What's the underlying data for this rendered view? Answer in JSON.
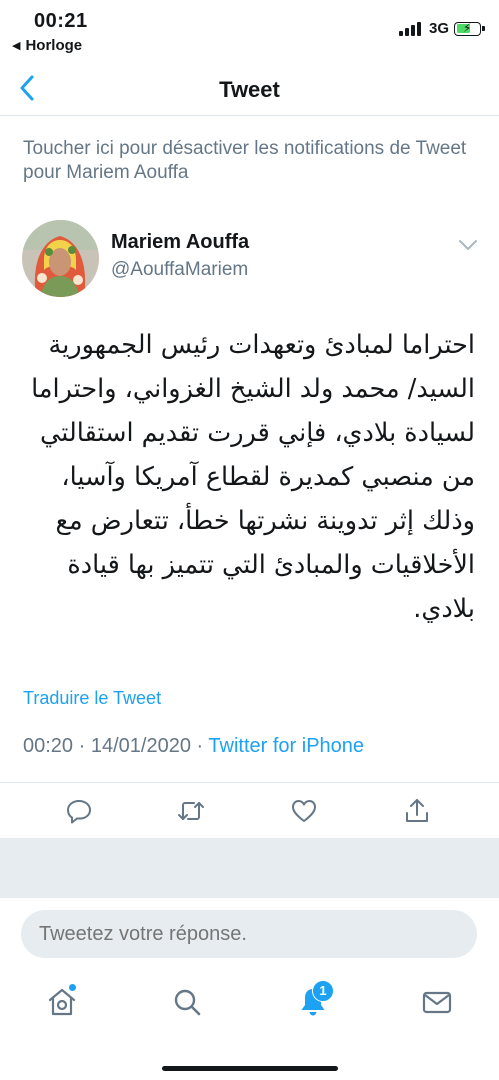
{
  "status_bar": {
    "time": "00:21",
    "back_app": "Horloge",
    "network": "3G"
  },
  "nav": {
    "title": "Tweet"
  },
  "notification_toggle": "Toucher ici pour désactiver les notifications de Tweet pour Mariem Aouffa",
  "tweet": {
    "author_name": "Mariem Aouffa",
    "author_handle": "@AouffaMariem",
    "text": "احتراما لمبادئ وتعهدات رئيس الجمهورية السيد/ محمد ولد الشيخ الغزواني، واحتراما لسيادة بلادي، فإني قررت تقديم استقالتي من منصبي كمديرة لقطاع آمريكا وآسيا، وذلك إثر تدوينة نشرتها خطأ، تتعارض مع الأخلاقيات والمبادئ التي تتميز بها قيادة بلادي.",
    "translate_label": "Traduire le Tweet",
    "time": "00:20",
    "date": "14/01/2020",
    "separator": "·",
    "source": "Twitter for iPhone"
  },
  "actions": {
    "icons": [
      "reply-icon",
      "retweet-icon",
      "like-icon",
      "share-icon"
    ]
  },
  "reply": {
    "placeholder": "Tweetez votre réponse."
  },
  "tab_bar": {
    "icons": [
      "home-icon",
      "search-icon",
      "notifications-icon",
      "messages-icon"
    ],
    "notification_count": "1"
  },
  "colors": {
    "accent": "#1da1f2",
    "secondary_text": "#657786",
    "divider": "#e1e8ed",
    "background_grey": "#e6ecf0"
  }
}
